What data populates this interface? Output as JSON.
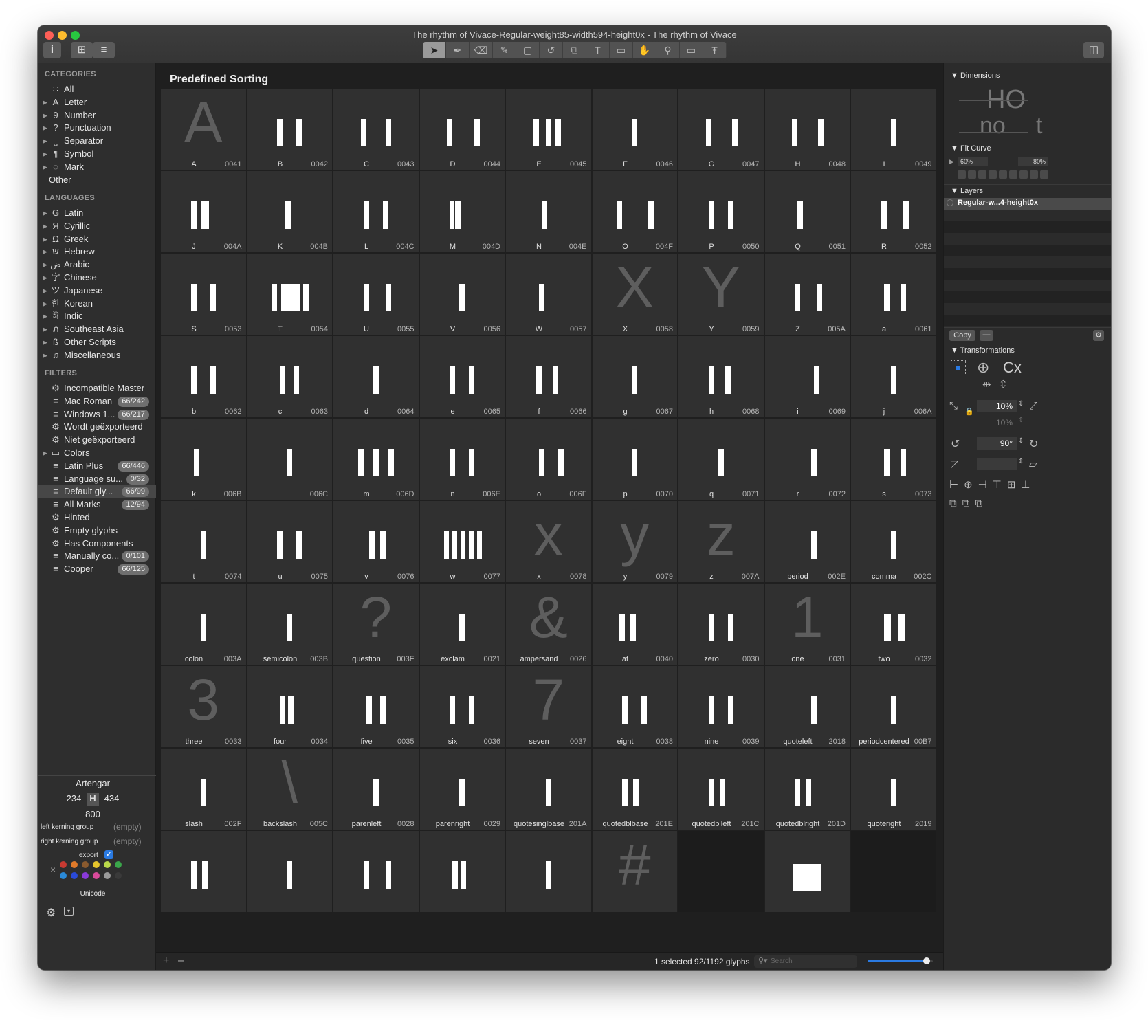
{
  "window": {
    "title": "The rhythm of Vivace-Regular-weight85-width594-height0x - The rhythm of Vivace"
  },
  "toolbar": {
    "info_label": "i",
    "grid_label": "⊞",
    "list_label": "≡",
    "panel_label": "◫",
    "tools": [
      "select",
      "draw",
      "erase",
      "pencil",
      "rectangle",
      "rotate",
      "scale",
      "text",
      "annotation",
      "hand",
      "zoom",
      "measure",
      "type"
    ]
  },
  "sidebar": {
    "categories_heading": "CATEGORIES",
    "categories": [
      {
        "label": "All",
        "icon": "all-icon",
        "glyph": "∷"
      },
      {
        "label": "Letter",
        "icon": "letter-icon",
        "glyph": "A"
      },
      {
        "label": "Number",
        "icon": "number-icon",
        "glyph": "9"
      },
      {
        "label": "Punctuation",
        "icon": "punctuation-icon",
        "glyph": "?"
      },
      {
        "label": "Separator",
        "icon": "separator-icon",
        "glyph": "⎵"
      },
      {
        "label": "Symbol",
        "icon": "symbol-icon",
        "glyph": "¶"
      },
      {
        "label": "Mark",
        "icon": "mark-icon",
        "glyph": "◌"
      },
      {
        "label": "Other",
        "icon": "",
        "glyph": ""
      }
    ],
    "languages_heading": "LANGUAGES",
    "languages": [
      {
        "label": "Latin",
        "glyph": "G"
      },
      {
        "label": "Cyrillic",
        "glyph": "Я"
      },
      {
        "label": "Greek",
        "glyph": "Ω"
      },
      {
        "label": "Hebrew",
        "glyph": "ש"
      },
      {
        "label": "Arabic",
        "glyph": "ض"
      },
      {
        "label": "Chinese",
        "glyph": "字"
      },
      {
        "label": "Japanese",
        "glyph": "ツ"
      },
      {
        "label": "Korean",
        "glyph": "한"
      },
      {
        "label": "Indic",
        "glyph": "ঈ"
      },
      {
        "label": "Southeast Asia",
        "glyph": "ภ"
      },
      {
        "label": "Other Scripts",
        "glyph": "ß"
      },
      {
        "label": "Miscellaneous",
        "glyph": "♫"
      }
    ],
    "filters_heading": "FILTERS",
    "filters": [
      {
        "label": "Incompatible Master",
        "icon": "gear",
        "badge": ""
      },
      {
        "label": "Mac Roman",
        "icon": "list",
        "badge": "66/242"
      },
      {
        "label": "Windows 1...",
        "icon": "list",
        "badge": "66/217"
      },
      {
        "label": "Wordt geëxporteerd",
        "icon": "gear",
        "badge": ""
      },
      {
        "label": "Niet geëxporteerd",
        "icon": "gear",
        "badge": ""
      },
      {
        "label": "Colors",
        "icon": "folder",
        "badge": ""
      },
      {
        "label": "Latin Plus",
        "icon": "list",
        "badge": "66/446"
      },
      {
        "label": "Language su...",
        "icon": "list",
        "badge": "0/32"
      },
      {
        "label": "Default gly...",
        "icon": "list",
        "badge": "66/99"
      },
      {
        "label": "All Marks",
        "icon": "list",
        "badge": "12/94"
      },
      {
        "label": "Hinted",
        "icon": "gear",
        "badge": ""
      },
      {
        "label": "Empty glyphs",
        "icon": "gear",
        "badge": ""
      },
      {
        "label": "Has Components",
        "icon": "gear",
        "badge": ""
      },
      {
        "label": "Manually co...",
        "icon": "list",
        "badge": "0/101"
      },
      {
        "label": "Cooper",
        "icon": "list",
        "badge": "66/125"
      }
    ],
    "info": {
      "glyph_name": "Artengar",
      "lsb": "234",
      "rsb": "434",
      "width": "800",
      "left_kerning_label": "left kerning group",
      "left_kerning_value": "(empty)",
      "right_kerning_label": "right kerning group",
      "right_kerning_value": "(empty)",
      "export_label": "export",
      "unicode_label": "Unicode",
      "color_swatches": [
        "#c83a32",
        "#e07a2a",
        "#8a5a2e",
        "#e6c52c",
        "#b9d84a",
        "#3aa64a",
        "#2a8ad8",
        "#2a4ad8",
        "#8a3ad8",
        "#d84a9a",
        "#9a9a9a",
        "#3a3a3a"
      ]
    }
  },
  "main": {
    "heading": "Predefined Sorting",
    "status": "1 selected 92/1192 glyphs",
    "search_placeholder": "Search",
    "zoom_slider": 0.9,
    "glyphs": [
      {
        "name": "A",
        "code": "0041",
        "show": "A"
      },
      {
        "name": "B",
        "code": "0042",
        "bars": [
          [
            -18,
            9
          ],
          [
            9,
            9
          ]
        ]
      },
      {
        "name": "C",
        "code": "0043",
        "bars": [
          [
            -22,
            8
          ],
          [
            14,
            8
          ]
        ]
      },
      {
        "name": "D",
        "code": "0044",
        "bars": [
          [
            -22,
            8
          ],
          [
            18,
            8
          ]
        ]
      },
      {
        "name": "E",
        "code": "0045",
        "bars": [
          [
            -22,
            8
          ],
          [
            -4,
            8
          ],
          [
            10,
            8
          ]
        ]
      },
      {
        "name": "F",
        "code": "0046",
        "bars": [
          [
            -4,
            8
          ]
        ]
      },
      {
        "name": "G",
        "code": "0047",
        "bars": [
          [
            -22,
            8
          ],
          [
            16,
            8
          ]
        ]
      },
      {
        "name": "H",
        "code": "0048",
        "bars": [
          [
            -22,
            8
          ],
          [
            16,
            8
          ]
        ]
      },
      {
        "name": "I",
        "code": "0049",
        "bars": [
          [
            -4,
            8
          ]
        ]
      },
      {
        "name": "J",
        "code": "004A",
        "bars": [
          [
            -18,
            8
          ],
          [
            -4,
            12
          ]
        ]
      },
      {
        "name": "K",
        "code": "004B",
        "bars": [
          [
            -6,
            8
          ]
        ]
      },
      {
        "name": "L",
        "code": "004C",
        "bars": [
          [
            -18,
            8
          ],
          [
            10,
            8
          ]
        ]
      },
      {
        "name": "M",
        "code": "004D",
        "bars": [
          [
            -18,
            6
          ],
          [
            -10,
            8
          ]
        ]
      },
      {
        "name": "N",
        "code": "004E",
        "bars": [
          [
            -10,
            8
          ]
        ]
      },
      {
        "name": "O",
        "code": "004F",
        "bars": [
          [
            -26,
            8
          ],
          [
            20,
            8
          ]
        ]
      },
      {
        "name": "P",
        "code": "0050",
        "bars": [
          [
            -18,
            8
          ],
          [
            10,
            8
          ]
        ]
      },
      {
        "name": "Q",
        "code": "0051",
        "bars": [
          [
            -14,
            8
          ]
        ]
      },
      {
        "name": "R",
        "code": "0052",
        "bars": [
          [
            -18,
            8
          ],
          [
            14,
            8
          ]
        ]
      },
      {
        "name": "S",
        "code": "0053",
        "bars": [
          [
            -18,
            8
          ],
          [
            10,
            8
          ]
        ]
      },
      {
        "name": "T",
        "code": "0054",
        "bars": [
          [
            -26,
            8
          ],
          [
            -12,
            28
          ],
          [
            20,
            8
          ]
        ]
      },
      {
        "name": "U",
        "code": "0055",
        "bars": [
          [
            -18,
            8
          ],
          [
            14,
            8
          ]
        ]
      },
      {
        "name": "V",
        "code": "0056",
        "bars": [
          [
            -4,
            8
          ]
        ]
      },
      {
        "name": "W",
        "code": "0057",
        "bars": [
          [
            -14,
            8
          ]
        ]
      },
      {
        "name": "X",
        "code": "0058",
        "show": "X"
      },
      {
        "name": "Y",
        "code": "0059",
        "show": "Y"
      },
      {
        "name": "Z",
        "code": "005A",
        "bars": [
          [
            -18,
            8
          ],
          [
            14,
            8
          ]
        ]
      },
      {
        "name": "a",
        "code": "0061",
        "bars": [
          [
            -14,
            8
          ],
          [
            10,
            8
          ]
        ]
      },
      {
        "name": "b",
        "code": "0062",
        "bars": [
          [
            -18,
            8
          ],
          [
            10,
            8
          ]
        ]
      },
      {
        "name": "c",
        "code": "0063",
        "bars": [
          [
            -14,
            8
          ],
          [
            6,
            8
          ]
        ]
      },
      {
        "name": "d",
        "code": "0064",
        "bars": [
          [
            -4,
            8
          ]
        ]
      },
      {
        "name": "e",
        "code": "0065",
        "bars": [
          [
            -18,
            8
          ],
          [
            10,
            8
          ]
        ]
      },
      {
        "name": "f",
        "code": "0066",
        "bars": [
          [
            -18,
            8
          ],
          [
            6,
            8
          ]
        ]
      },
      {
        "name": "g",
        "code": "0067",
        "bars": [
          [
            -4,
            8
          ]
        ]
      },
      {
        "name": "h",
        "code": "0068",
        "bars": [
          [
            -18,
            8
          ],
          [
            6,
            8
          ]
        ]
      },
      {
        "name": "i",
        "code": "0069",
        "bars": [
          [
            10,
            8
          ]
        ]
      },
      {
        "name": "j",
        "code": "006A",
        "bars": [
          [
            -4,
            8
          ]
        ]
      },
      {
        "name": "k",
        "code": "006B",
        "bars": [
          [
            -14,
            8
          ]
        ]
      },
      {
        "name": "l",
        "code": "006C",
        "bars": [
          [
            -4,
            8
          ]
        ]
      },
      {
        "name": "m",
        "code": "006D",
        "bars": [
          [
            -26,
            8
          ],
          [
            -4,
            8
          ],
          [
            18,
            8
          ]
        ]
      },
      {
        "name": "n",
        "code": "006E",
        "bars": [
          [
            -18,
            8
          ],
          [
            10,
            8
          ]
        ]
      },
      {
        "name": "o",
        "code": "006F",
        "bars": [
          [
            -14,
            8
          ],
          [
            14,
            8
          ]
        ]
      },
      {
        "name": "p",
        "code": "0070",
        "bars": [
          [
            -4,
            8
          ]
        ]
      },
      {
        "name": "q",
        "code": "0071",
        "bars": [
          [
            -4,
            8
          ]
        ]
      },
      {
        "name": "r",
        "code": "0072",
        "bars": [
          [
            6,
            8
          ]
        ]
      },
      {
        "name": "s",
        "code": "0073",
        "bars": [
          [
            -14,
            8
          ],
          [
            10,
            8
          ]
        ]
      },
      {
        "name": "t",
        "code": "0074",
        "bars": [
          [
            -4,
            8
          ]
        ]
      },
      {
        "name": "u",
        "code": "0075",
        "bars": [
          [
            -18,
            8
          ],
          [
            10,
            8
          ]
        ]
      },
      {
        "name": "v",
        "code": "0076",
        "bars": [
          [
            -10,
            8
          ],
          [
            6,
            8
          ]
        ]
      },
      {
        "name": "w",
        "code": "0077",
        "bars": [
          [
            -26,
            7
          ],
          [
            -14,
            7
          ],
          [
            -2,
            7
          ],
          [
            10,
            7
          ],
          [
            22,
            7
          ]
        ]
      },
      {
        "name": "x",
        "code": "0078",
        "show": "x"
      },
      {
        "name": "y",
        "code": "0079",
        "show": "y"
      },
      {
        "name": "z",
        "code": "007A",
        "show": "z"
      },
      {
        "name": "period",
        "code": "002E",
        "bars": [
          [
            6,
            8
          ]
        ]
      },
      {
        "name": "comma",
        "code": "002C",
        "bars": [
          [
            -4,
            8
          ]
        ]
      },
      {
        "name": "colon",
        "code": "003A",
        "bars": [
          [
            -4,
            8
          ]
        ]
      },
      {
        "name": "semicolon",
        "code": "003B",
        "bars": [
          [
            -4,
            8
          ]
        ]
      },
      {
        "name": "question",
        "code": "003F",
        "show": "?"
      },
      {
        "name": "exclam",
        "code": "0021",
        "bars": [
          [
            -4,
            8
          ]
        ]
      },
      {
        "name": "ampersand",
        "code": "0026",
        "show": "&"
      },
      {
        "name": "at",
        "code": "0040",
        "bars": [
          [
            -22,
            8
          ],
          [
            -6,
            8
          ]
        ]
      },
      {
        "name": "zero",
        "code": "0030",
        "bars": [
          [
            -18,
            8
          ],
          [
            10,
            8
          ]
        ]
      },
      {
        "name": "one",
        "code": "0031",
        "show": "1"
      },
      {
        "name": "two",
        "code": "0032",
        "bars": [
          [
            -14,
            10
          ],
          [
            6,
            10
          ]
        ]
      },
      {
        "name": "three",
        "code": "0033",
        "show": "3"
      },
      {
        "name": "four",
        "code": "0034",
        "bars": [
          [
            -14,
            8
          ],
          [
            -2,
            8
          ]
        ]
      },
      {
        "name": "five",
        "code": "0035",
        "bars": [
          [
            -14,
            8
          ],
          [
            6,
            8
          ]
        ]
      },
      {
        "name": "six",
        "code": "0036",
        "bars": [
          [
            -18,
            8
          ],
          [
            10,
            8
          ]
        ]
      },
      {
        "name": "seven",
        "code": "0037",
        "show": "7"
      },
      {
        "name": "eight",
        "code": "0038",
        "bars": [
          [
            -18,
            8
          ],
          [
            10,
            8
          ]
        ]
      },
      {
        "name": "nine",
        "code": "0039",
        "bars": [
          [
            -18,
            8
          ],
          [
            10,
            8
          ]
        ]
      },
      {
        "name": "quoteleft",
        "code": "2018",
        "bars": [
          [
            6,
            8
          ]
        ]
      },
      {
        "name": "periodcentered",
        "code": "00B7",
        "bars": [
          [
            -4,
            8
          ]
        ]
      },
      {
        "name": "slash",
        "code": "002F",
        "bars": [
          [
            -4,
            8
          ]
        ]
      },
      {
        "name": "backslash",
        "code": "005C",
        "show": "\\"
      },
      {
        "name": "parenleft",
        "code": "0028",
        "bars": [
          [
            -4,
            8
          ]
        ]
      },
      {
        "name": "parenright",
        "code": "0029",
        "bars": [
          [
            -4,
            8
          ]
        ]
      },
      {
        "name": "quotesinglbase",
        "code": "201A",
        "bars": [
          [
            -4,
            8
          ]
        ]
      },
      {
        "name": "quotedblbase",
        "code": "201E",
        "bars": [
          [
            -18,
            8
          ],
          [
            -2,
            8
          ]
        ]
      },
      {
        "name": "quotedblleft",
        "code": "201C",
        "bars": [
          [
            -18,
            8
          ],
          [
            -2,
            8
          ]
        ]
      },
      {
        "name": "quotedblright",
        "code": "201D",
        "bars": [
          [
            -18,
            8
          ],
          [
            -2,
            8
          ]
        ]
      },
      {
        "name": "quoteright",
        "code": "2019",
        "bars": [
          [
            -4,
            8
          ]
        ]
      },
      {
        "name": "",
        "code": "",
        "bars": [
          [
            -18,
            8
          ],
          [
            -2,
            8
          ]
        ]
      },
      {
        "name": "",
        "code": "",
        "bars": [
          [
            -4,
            8
          ]
        ]
      },
      {
        "name": "",
        "code": "",
        "bars": [
          [
            -18,
            8
          ],
          [
            14,
            8
          ]
        ]
      },
      {
        "name": "",
        "code": "",
        "bars": [
          [
            -14,
            8
          ],
          [
            -2,
            8
          ]
        ]
      },
      {
        "name": "",
        "code": "",
        "bars": [
          [
            -4,
            8
          ]
        ]
      },
      {
        "name": "",
        "code": "",
        "show": "#"
      },
      {
        "name": "",
        "code": "",
        "empty": true
      },
      {
        "name": "",
        "code": "",
        "bars": [
          [
            -20,
            40
          ]
        ]
      },
      {
        "name": "",
        "code": "",
        "empty": true
      }
    ]
  },
  "right_panel": {
    "dimensions_label": "Dimensions",
    "fit_curve_label": "Fit Curve",
    "fit_min": "60%",
    "fit_max": "80%",
    "layers_label": "Layers",
    "layer_name": "Regular-w...4-height0x",
    "copy_label": "Copy",
    "transformations_label": "Transformations",
    "cx_label": "Cx",
    "scale_x": "10%",
    "scale_y": "10%",
    "rotate": "90°",
    "slant": ""
  }
}
